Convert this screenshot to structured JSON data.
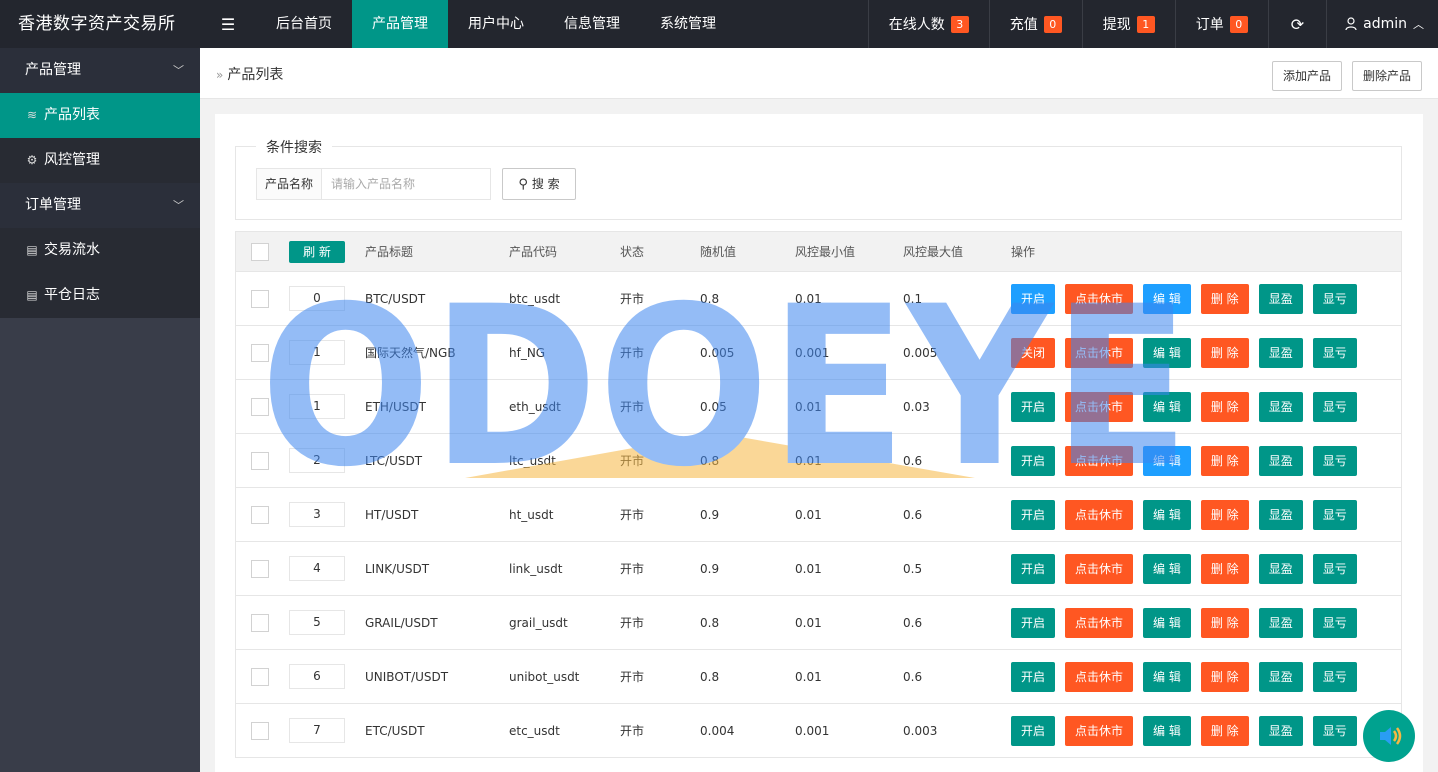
{
  "app": {
    "title": "香港数字资产交易所"
  },
  "topnav": {
    "items": [
      "后台首页",
      "产品管理",
      "用户中心",
      "信息管理",
      "系统管理"
    ],
    "online_label": "在线人数",
    "online_count": "3",
    "recharge_label": "充值",
    "recharge_count": "0",
    "withdraw_label": "提现",
    "withdraw_count": "1",
    "order_label": "订单",
    "order_count": "0",
    "user": "admin"
  },
  "sidebar": {
    "group1": "产品管理",
    "item_products": "产品列表",
    "item_risk": "风控管理",
    "group2": "订单管理",
    "item_flow": "交易流水",
    "item_close": "平仓日志"
  },
  "breadcrumb": "产品列表",
  "toolbar": {
    "add": "添加产品",
    "delete": "删除产品"
  },
  "search": {
    "legend": "条件搜索",
    "label": "产品名称",
    "placeholder": "请输入产品名称",
    "button": "搜 索"
  },
  "table": {
    "refresh": "刷 新",
    "headers": [
      "产品标题",
      "产品代码",
      "状态",
      "随机值",
      "风控最小值",
      "风控最大值",
      "操作"
    ],
    "rows": [
      {
        "sort": "0",
        "title": "BTC/USDT",
        "code": "btc_usdt",
        "status": "开市",
        "random": "0.8",
        "min": "0.01",
        "max": "0.1",
        "toggle": "开启",
        "toggle_color": "#1e9fff",
        "edit_color": "#1e9fff"
      },
      {
        "sort": "1",
        "title": "国际天然气/NGB",
        "code": "hf_NG",
        "status": "开市",
        "random": "0.005",
        "min": "0.001",
        "max": "0.005",
        "toggle": "关闭",
        "toggle_color": "#ff5722",
        "edit_color": "#009688"
      },
      {
        "sort": "1",
        "title": "ETH/USDT",
        "code": "eth_usdt",
        "status": "开市",
        "random": "0.05",
        "min": "0.01",
        "max": "0.03",
        "toggle": "开启",
        "toggle_color": "#009688",
        "edit_color": "#009688"
      },
      {
        "sort": "2",
        "title": "LTC/USDT",
        "code": "ltc_usdt",
        "status": "开市",
        "random": "0.8",
        "min": "0.01",
        "max": "0.6",
        "toggle": "开启",
        "toggle_color": "#009688",
        "edit_color": "#1e9fff"
      },
      {
        "sort": "3",
        "title": "HT/USDT",
        "code": "ht_usdt",
        "status": "开市",
        "random": "0.9",
        "min": "0.01",
        "max": "0.6",
        "toggle": "开启",
        "toggle_color": "#009688",
        "edit_color": "#009688"
      },
      {
        "sort": "4",
        "title": "LINK/USDT",
        "code": "link_usdt",
        "status": "开市",
        "random": "0.9",
        "min": "0.01",
        "max": "0.5",
        "toggle": "开启",
        "toggle_color": "#009688",
        "edit_color": "#009688"
      },
      {
        "sort": "5",
        "title": "GRAIL/USDT",
        "code": "grail_usdt",
        "status": "开市",
        "random": "0.8",
        "min": "0.01",
        "max": "0.6",
        "toggle": "开启",
        "toggle_color": "#009688",
        "edit_color": "#009688"
      },
      {
        "sort": "6",
        "title": "UNIBOT/USDT",
        "code": "unibot_usdt",
        "status": "开市",
        "random": "0.8",
        "min": "0.01",
        "max": "0.6",
        "toggle": "开启",
        "toggle_color": "#009688",
        "edit_color": "#009688"
      },
      {
        "sort": "7",
        "title": "ETC/USDT",
        "code": "etc_usdt",
        "status": "开市",
        "random": "0.004",
        "min": "0.001",
        "max": "0.003",
        "toggle": "开启",
        "toggle_color": "#009688",
        "edit_color": "#009688"
      }
    ],
    "btn_close_market": "点击休市",
    "btn_edit": "编 辑",
    "btn_delete": "删 除",
    "btn_profit": "显盈",
    "btn_loss": "显亏"
  },
  "watermark": "ODOEYE",
  "colors": {
    "accent": "#009688",
    "danger": "#ff5722",
    "info": "#1e9fff",
    "header_bg": "#23262e",
    "sidebar_bg": "#393d49"
  }
}
